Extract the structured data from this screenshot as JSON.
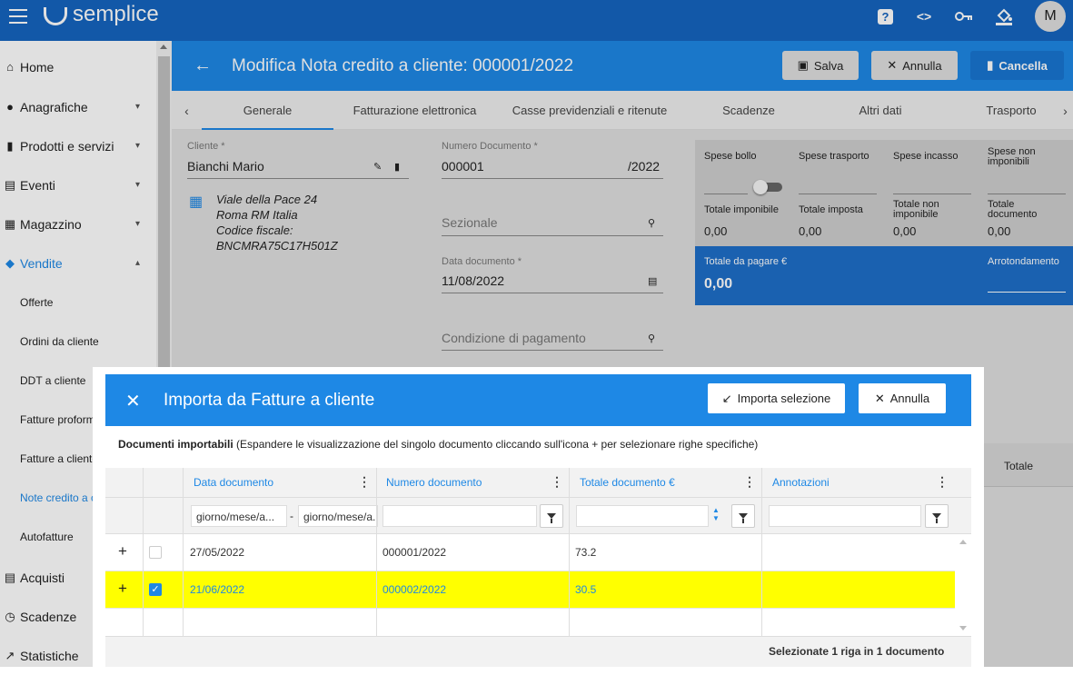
{
  "app": {
    "logo": "semplice",
    "avatar_initial": "M"
  },
  "topbar": {
    "icons": [
      "help-icon",
      "code-icon",
      "key-icon",
      "paint-bucket-icon"
    ],
    "help_glyph": "?",
    "code_glyph": "<>"
  },
  "sidebar": {
    "items": [
      {
        "label": "Home",
        "icon": "home-icon"
      },
      {
        "label": "Anagrafiche",
        "icon": "people-icon"
      },
      {
        "label": "Prodotti e servizi",
        "icon": "book-icon"
      },
      {
        "label": "Eventi",
        "icon": "calendar-icon"
      },
      {
        "label": "Magazzino",
        "icon": "warehouse-icon"
      },
      {
        "label": "Vendite",
        "icon": "basket-icon"
      }
    ],
    "sub_items": [
      "Offerte",
      "Ordini da cliente",
      "DDT a cliente",
      "Fatture proforma",
      "Fatture a cliente",
      "Note credito a cliente",
      "Autofatture"
    ],
    "bottom_items": [
      {
        "label": "Acquisti",
        "icon": "receipt-icon"
      },
      {
        "label": "Scadenze",
        "icon": "clock-icon"
      },
      {
        "label": "Statistiche",
        "icon": "trend-icon"
      }
    ]
  },
  "header": {
    "title": "Modifica Nota credito a cliente: 000001/2022",
    "save": "Salva",
    "cancel": "Annulla",
    "delete": "Cancella"
  },
  "tabs": [
    "Generale",
    "Fatturazione elettronica",
    "Casse previdenziali e ritenute",
    "Scadenze",
    "Altri dati",
    "Trasporto"
  ],
  "form": {
    "cliente_label": "Cliente *",
    "cliente_value": "Bianchi Mario",
    "address": [
      "Viale della Pace 24",
      "Roma RM Italia",
      "Codice fiscale:",
      "BNCMRA75C17H501Z"
    ],
    "numero_label": "Numero Documento *",
    "numero_value": "000001",
    "numero_suffix": "/2022",
    "sezionale_placeholder": "Sezionale",
    "data_label": "Data documento *",
    "data_value": "11/08/2022",
    "condizione_placeholder": "Condizione di pagamento"
  },
  "totals": {
    "spese_bollo": "Spese bollo",
    "spese_trasporto": "Spese trasporto",
    "spese_incasso": "Spese incasso",
    "spese_non_imponibili": "Spese non imponibili",
    "totale_imponibile": "Totale imponibile",
    "totale_imposta": "Totale imposta",
    "totale_non_imponibile": "Totale non imponibile",
    "totale_documento": "Totale documento",
    "values": [
      "0,00",
      "0,00",
      "0,00",
      "0,00"
    ],
    "totale_pagare_label": "Totale da pagare €",
    "totale_pagare_value": "0,00",
    "arrotondamento": "Arrotondamento",
    "bollo_enabled": false
  },
  "behind_grid": {
    "totale_header": "Totale"
  },
  "modal": {
    "title": "Importa da Fatture a cliente",
    "import_button": "Importa selezione",
    "cancel_button": "Annulla",
    "subtitle_bold": "Documenti importabili",
    "subtitle_rest": " (Espandere le visualizzazione del singolo documento cliccando sull'icona + per selezionare righe specifiche)",
    "columns": [
      "Data documento",
      "Numero documento",
      "Totale documento €",
      "Annotazioni"
    ],
    "filters": {
      "date_from_placeholder": "giorno/mese/a...",
      "date_separator": "-",
      "date_to_placeholder": "giorno/mese/a..."
    },
    "rows": [
      {
        "data": "27/05/2022",
        "numero": "000001/2022",
        "totale": "73.2",
        "annotazioni": "",
        "selected": false
      },
      {
        "data": "21/06/2022",
        "numero": "000002/2022",
        "totale": "30.5",
        "annotazioni": "",
        "selected": true
      }
    ],
    "footer": "Selezionate 1 riga in 1 documento",
    "plus_glyph": "+",
    "check_glyph": "✓"
  },
  "colors": {
    "primary": "#1e88e5",
    "topbar": "#1565c0",
    "selected_row": "#ffff00"
  }
}
